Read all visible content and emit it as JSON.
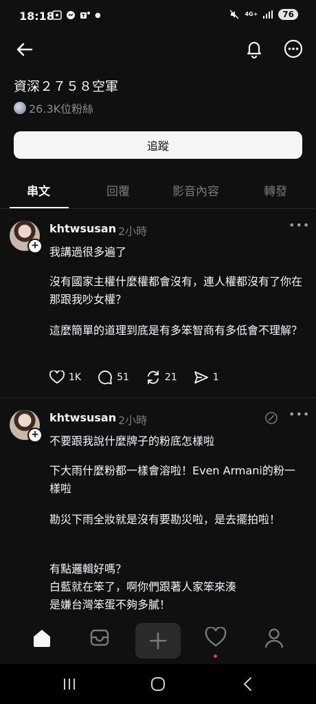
{
  "status_bar": {
    "time": "18:18",
    "network": "4G+",
    "battery": "76"
  },
  "profile": {
    "name": "資深２７５８空軍",
    "followers": "26.3K位粉絲",
    "follow_label": "追蹤"
  },
  "tabs": [
    "串文",
    "回覆",
    "影音內容",
    "轉發"
  ],
  "posts": [
    {
      "username": "khtwsusan",
      "time": "2小時",
      "paragraphs": [
        "我講過很多遍了",
        "沒有國家主權什麼權都會沒有，連人權都沒有了你在那跟我吵女權？",
        "這麼簡單的道理到底是有多笨智商有多低會不理解？"
      ],
      "likes": "1K",
      "comments": "51",
      "reposts": "21",
      "shares": "1"
    },
    {
      "username": "khtwsusan",
      "time": "2小時",
      "paragraphs": [
        "不要跟我說什麼牌子的粉底怎樣啦",
        "下大雨什麼粉都一樣會溶啦！Even Armani的粉一樣啦",
        "勘災下雨全妝就是沒有要勘災啦，是去擺拍啦！",
        "有點邏輯好嗎？\n白藍就在笨了，啊你們跟著人家笨來湊\n是嫌台灣笨蛋不夠多膩！"
      ]
    }
  ]
}
